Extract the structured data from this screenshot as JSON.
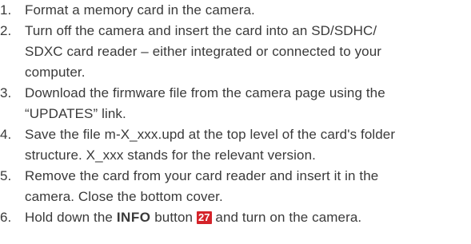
{
  "steps": [
    {
      "number": "1.",
      "lines": [
        "Format a memory card in the camera."
      ]
    },
    {
      "number": "2.",
      "lines": [
        "Turn off the camera and insert the card into an SD/SDHC/",
        "SDXC card reader – either integrated or connected to your",
        "computer."
      ]
    },
    {
      "number": "3.",
      "lines": [
        "Download the firmware file from the camera page using the",
        "“UPDATES” link."
      ]
    },
    {
      "number": "4.",
      "lines": [
        "Save the file m-X_xxx.upd at the top level of the card's folder",
        "structure. X_xxx stands for the relevant version."
      ]
    },
    {
      "number": "5.",
      "lines": [
        "Remove the card from your card reader and insert it in the",
        "camera. Close the bottom cover."
      ]
    },
    {
      "number": "6.",
      "text_before": "Hold down the ",
      "key_label": "INFO",
      "text_middle": " button ",
      "reference_badge": "27",
      "text_after": " and turn on the camera."
    }
  ],
  "colors": {
    "text": "#3a3a3a",
    "badge_background": "#d4232a",
    "badge_text": "#ffffff"
  }
}
